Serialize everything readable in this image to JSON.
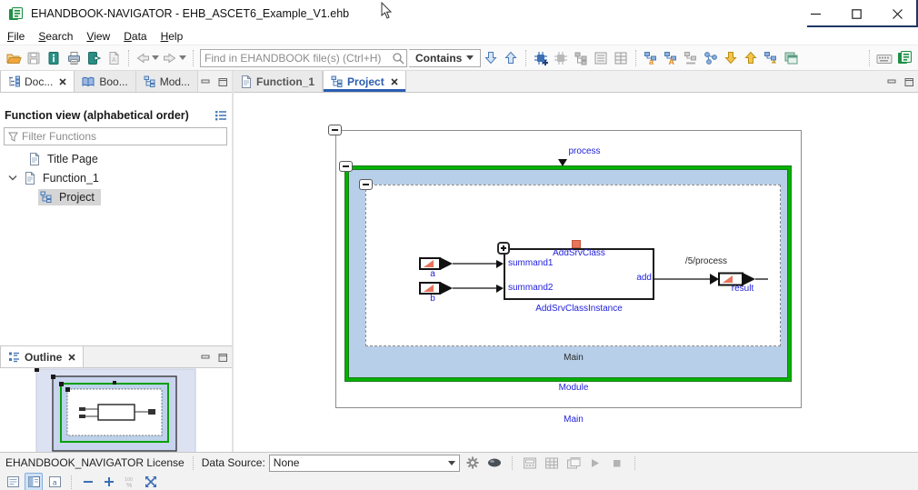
{
  "window": {
    "title": "EHANDBOOK-NAVIGATOR - EHB_ASCET6_Example_V1.ehb"
  },
  "menubar": {
    "items": [
      "File",
      "Search",
      "View",
      "Data",
      "Help"
    ]
  },
  "toolbar": {
    "search_placeholder": "Find in EHANDBOOK file(s) (Ctrl+H)",
    "contains_label": "Contains"
  },
  "left_panel": {
    "tabs": [
      {
        "label": "Doc..."
      },
      {
        "label": "Boo..."
      },
      {
        "label": "Mod..."
      }
    ],
    "header": "Function view (alphabetical order)",
    "filter_placeholder": "Filter Functions",
    "tree": [
      {
        "label": "Title Page"
      },
      {
        "label": "Function_1"
      },
      {
        "label": "Project"
      }
    ]
  },
  "outline": {
    "tab_label": "Outline"
  },
  "editor": {
    "tabs": [
      {
        "label": "Function_1"
      },
      {
        "label": "Project"
      }
    ]
  },
  "diagram": {
    "process": "process",
    "module": "Module",
    "main_inner": "Main",
    "main_outer": "Main",
    "block_class": "AddSrvClass",
    "block_instance": "AddSrvClassInstance",
    "in1": "summand1",
    "in2": "summand2",
    "out_pin": "add",
    "port_a": "a",
    "port_b": "b",
    "result": "result",
    "path": "/5/process"
  },
  "status": {
    "license": "EHANDBOOK_NAVIGATOR License",
    "data_source_label": "Data Source:",
    "data_source_value": "None",
    "zoom_level_label": "100%"
  },
  "icons": {
    "titlebar": [
      "app-icon",
      "minimize-icon",
      "maximize-icon",
      "close-icon"
    ],
    "toolbar": [
      "open-folder-icon",
      "save-icon",
      "book-info-icon",
      "print-icon",
      "export-book-icon",
      "pdf-export-icon",
      "back-icon",
      "forward-icon",
      "search-icon",
      "arrow-down-icon",
      "arrow-up-icon",
      "chip-add-icon",
      "chip-icon",
      "model-tree-icon",
      "list-view-icon",
      "table-view-icon",
      "tree-lowercase-a-icon",
      "tree-uppercase-a-icon",
      "tree-gray-icon",
      "nodes-icon",
      "gold-arrow-down-icon",
      "gold-arrow-up-icon",
      "tree-gold-arrow-icon",
      "windows-icon",
      "keyboard-icon",
      "ehb-icon"
    ],
    "statusbar": [
      "gear-icon",
      "lens-icon",
      "instrument-icon",
      "calibration-grid-icon",
      "floating-window-icon",
      "play-icon",
      "stop-icon",
      "page-view-icon",
      "split-view-icon",
      "annotation-view-icon",
      "zoom-out-icon",
      "zoom-in-icon",
      "zoom-100-icon",
      "fit-to-screen-icon"
    ]
  },
  "colors": {
    "tab-blue": "#2a5db0",
    "diagram-green": "#00b200",
    "module-fill": "#b7cfe8",
    "label-blue": "#2121dd",
    "salmon": "#e8745a"
  }
}
